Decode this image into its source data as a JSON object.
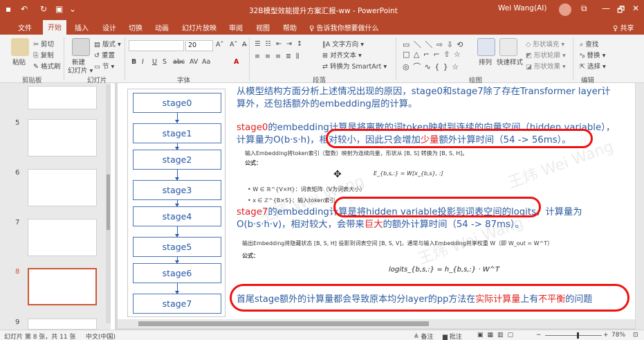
{
  "window": {
    "title": "32B模型效能提升方案汇报-ww  -  PowerPoint",
    "user": "Wei Wang(AI)",
    "min": "—",
    "restore": "🗗",
    "close": "✕",
    "ribbon_toggle": "⧉"
  },
  "quick_access": {
    "save_icon": "save-icon",
    "undo": "↶",
    "redo": "↻",
    "present": "▣",
    "more": "⌄"
  },
  "tabs": [
    "文件",
    "开始",
    "插入",
    "设计",
    "切换",
    "动画",
    "幻灯片放映",
    "审阅",
    "视图",
    "帮助",
    "♀ 告诉我你想要做什么"
  ],
  "share": "♀ 共享",
  "ribbon": {
    "clipboard": {
      "paste": "粘贴",
      "cut": "✂ 剪切",
      "copy": "⎘ 复制",
      "format": "✎ 格式刷",
      "group": "剪贴板"
    },
    "slides": {
      "new": "新建",
      "new2": "幻灯片 ▾",
      "layout": "▤ 版式 ▾",
      "reset": "↺ 重置",
      "section": "▭ 节 ▾",
      "group": "幻灯片"
    },
    "font": {
      "size": "20",
      "grow": "A˄",
      "shrink": "A˅",
      "clear": "A̶",
      "bold": "B",
      "italic": "I",
      "underline": "U",
      "strike": "S",
      "shadow": "abc",
      "spacing": "AV",
      "case": "Aa",
      "color": "A",
      "group": "字体"
    },
    "paragraph": {
      "dir": "‖A 文字方向 ▾",
      "align": "⊞ 对齐文本 ▾",
      "smartart": "⇄ 转换为 SmartArt ▾",
      "group": "段落"
    },
    "drawing": {
      "arrange": "排列",
      "quick": "快速样式",
      "fill": "◇ 形状填充 ▾",
      "outline": "◩ 形状轮廓 ▾",
      "effect": "◪ 形状效果 ▾",
      "group": "绘图"
    },
    "editing": {
      "find": "⌕ 查找",
      "replace": "ᵃᵦ 替换 ▾",
      "select": "⇱ 选择 ▾",
      "group": "编辑"
    }
  },
  "thumbnails": [
    {
      "num": "5"
    },
    {
      "num": "6"
    },
    {
      "num": "7"
    },
    {
      "num": "8",
      "selected": true
    },
    {
      "num": "9"
    }
  ],
  "slide": {
    "stages": [
      "stage0",
      "stage1",
      "stage2",
      "stage3",
      "stage4",
      "stage5",
      "stage6",
      "stage7"
    ],
    "line1a": "从模型结构方面分析上述情况出现的原因，stage0和stage7除了存在Transformer layer计",
    "line1b": "算外，还包括额外的embedding层的计算。",
    "s0_a1": "stage0",
    "s0_a2": "的embedding计算是将离散的词token映射到连续的向量空间（hidden variable），",
    "s0_b1": "计算量为O(b·s·h)，相对较小，",
    "s0_b2": "因此只会增加",
    "s0_b3": "少量",
    "s0_b4": "额外计算时间（54 -> 56ms）。",
    "emb_desc": "输入Embedding将token索引（整数）映射为连续向量，形状从 [B, S] 转换为 [B, S, H]。",
    "formula_label": "公式：",
    "formula1": "E_{b,s,:} = W[x_{b,s}, :]",
    "bullet1": "• W ∈ ℝ^{V×H}：词表矩阵（V为词表大小）",
    "bullet2": "• x ∈ ℤ^{B×S}：输入token索引",
    "s7_a1": "stage7",
    "s7_a2": "的embedding计算是将hidden variable投影到词表空间的logits，计算量为",
    "s7_b1": "O(b·s·h·v)，相对较大，会带来",
    "s7_b2": "巨大",
    "s7_b3": "的额外计算时间（54 -> 87ms）。",
    "out_desc": "输出Embedding将隐藏状态 [B, S, H] 投影到词表空间 [B, S, V]，通常与输入Embedding共享权重 W（即 W_out = W^T）",
    "formula2": "logits_{b,s,:} = h_{b,s,:} · W^T",
    "c1": "首尾stage额外的计算量都会导致原本均分layer的pp方法在",
    "c2": "实际计算量",
    "c3": "上有",
    "c4": "不平衡",
    "c5": "的问题"
  },
  "status": {
    "slide": "幻灯片 第 8 张，共 11 张",
    "lang": "中文(中国)",
    "notes": "≜ 备注",
    "comments": "▆ 批注",
    "zoom": "78%",
    "minus": "−",
    "plus": "+",
    "fit": "⊡"
  },
  "colors": {
    "accent": "#b7472a",
    "stage_border": "#4a74b5",
    "red": "#e02020"
  }
}
